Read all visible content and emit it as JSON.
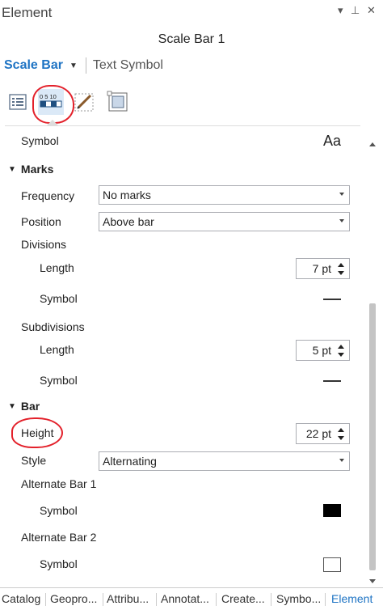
{
  "pane": {
    "title": "Element",
    "dropdown_glyph": "▾",
    "pin_glyph": "⊥",
    "close_glyph": "✕"
  },
  "element_name": "Scale Bar 1",
  "selector": {
    "active": "Scale Bar",
    "other": "Text Symbol"
  },
  "toolbar": {
    "tools": [
      {
        "name": "properties-icon"
      },
      {
        "name": "scale-bar-icon",
        "text": "0  5  10",
        "selected": true
      },
      {
        "name": "pencil-icon"
      },
      {
        "name": "frame-icon"
      }
    ]
  },
  "content": {
    "top_symbol_label": "Symbol",
    "top_symbol_preview": "Aa",
    "marks": {
      "header": "Marks",
      "frequency_label": "Frequency",
      "frequency_value": "No marks",
      "position_label": "Position",
      "position_value": "Above bar",
      "divisions_label": "Divisions",
      "div_length_label": "Length",
      "div_length_value": "7 pt",
      "div_symbol_label": "Symbol",
      "subdivisions_label": "Subdivisions",
      "sub_length_label": "Length",
      "sub_length_value": "5 pt",
      "sub_symbol_label": "Symbol"
    },
    "bar": {
      "header": "Bar",
      "height_label": "Height",
      "height_value": "22 pt",
      "style_label": "Style",
      "style_value": "Alternating",
      "alt1_label": "Alternate Bar 1",
      "alt1_symbol_label": "Symbol",
      "alt2_label": "Alternate Bar 2",
      "alt2_symbol_label": "Symbol"
    }
  },
  "bottom_tabs": [
    "Catalog",
    "Geopro...",
    "Attribu...",
    "Annotat...",
    "Create...",
    "Symbo...",
    "Element"
  ],
  "colors": {
    "accent": "#1f74c4",
    "annotation_red": "#e3212b"
  }
}
